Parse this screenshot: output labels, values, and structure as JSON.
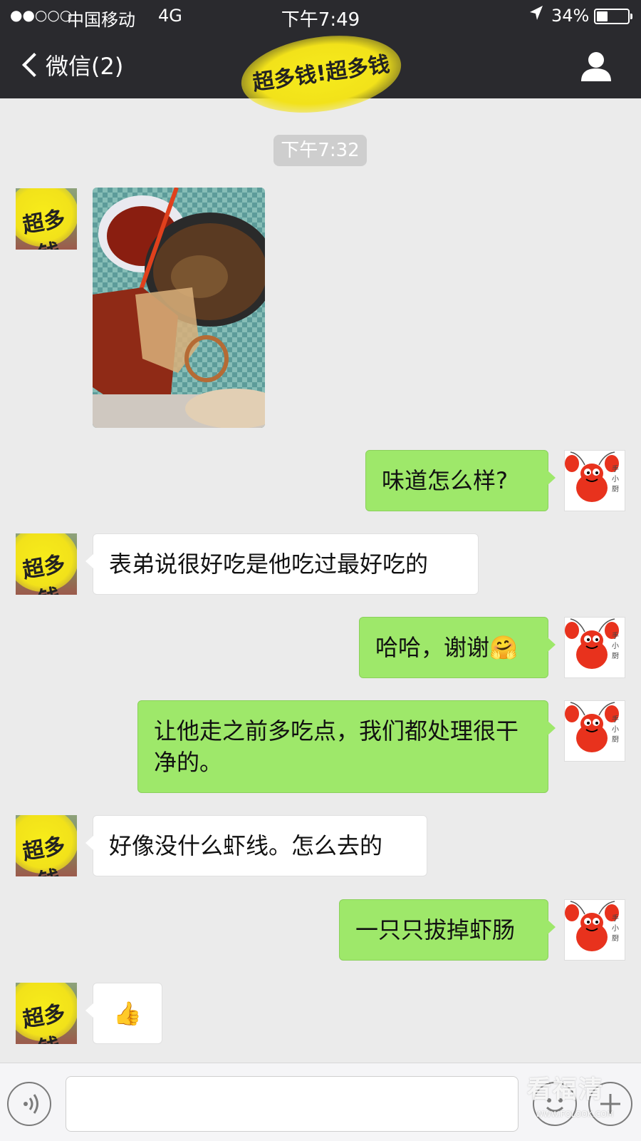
{
  "status_bar": {
    "signal": "●●○○○",
    "carrier": "中国移动",
    "network": "4G",
    "time": "下午7:49",
    "battery": "34%"
  },
  "nav": {
    "back_label": "微信(2)",
    "title_overlay": "超多钱!超多钱"
  },
  "chat": {
    "timestamp": "下午7:32",
    "peer_avatar_text": "超多钱",
    "my_avatar_text": "手小厨",
    "messages": [
      {
        "from": "me",
        "text": "味道怎么样?"
      },
      {
        "from": "peer",
        "text": "表弟说很好吃是他吃过最好吃的"
      },
      {
        "from": "me",
        "text": "哈哈，谢谢🤗"
      },
      {
        "from": "me",
        "text": "让他走之前多吃点，我们都处理很干净的。"
      },
      {
        "from": "peer",
        "text": "好像没什么虾线。怎么去的"
      },
      {
        "from": "me",
        "text": "一只只拔掉虾肠"
      },
      {
        "from": "peer",
        "text": "👍"
      }
    ]
  },
  "input": {
    "placeholder": ""
  },
  "watermark": {
    "brand": "看福清",
    "url": "WWW.FQLOOK.COM"
  },
  "colors": {
    "nav_bg": "#2a2a2e",
    "chat_bg": "#ebebeb",
    "my_bubble": "#9ee86a",
    "peer_bubble": "#ffffff"
  }
}
